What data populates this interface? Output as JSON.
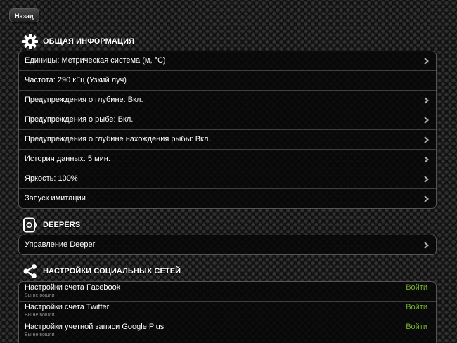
{
  "nav": {
    "back_label": "Назад"
  },
  "general": {
    "title": "ОБЩАЯ ИНФОРМАЦИЯ",
    "icon": "gear-icon",
    "items": [
      {
        "label": "Единицы: Метрическая система (м, °C)",
        "chevron": true
      },
      {
        "label": "Частота: 290 кГц (Узкий луч)",
        "chevron": false
      },
      {
        "label": "Предупреждения о глубине: Вкл.",
        "chevron": true
      },
      {
        "label": "Предупреждения о рыбе: Вкл.",
        "chevron": true
      },
      {
        "label": "Предупреждения о глубине нахождения рыбы: Вкл.",
        "chevron": true
      },
      {
        "label": "История данных: 5 мин.",
        "chevron": true
      },
      {
        "label": "Яркость: 100%",
        "chevron": true
      },
      {
        "label": "Запуск имитации",
        "chevron": true
      }
    ]
  },
  "deepers": {
    "title": "DEEPERS",
    "icon": "phone-device-icon",
    "items": [
      {
        "label": "Управление Deeper",
        "chevron": true
      }
    ]
  },
  "social": {
    "title": "НАСТРОЙКИ СОЦИАЛЬНЫХ СЕТЕЙ",
    "icon": "share-icon",
    "items": [
      {
        "label": "Настройки счета Facebook",
        "status": "Вы не вошли",
        "action": "Войти"
      },
      {
        "label": "Настройки счета Twitter",
        "status": "Вы не вошли",
        "action": "Войти"
      },
      {
        "label": "Настройки учетной записи Google Plus",
        "status": "Вы не вошли",
        "action": "Войти"
      }
    ]
  },
  "colors": {
    "accent_green": "#77b02a",
    "group_border": "#555555",
    "text": "#ffffff",
    "subtext": "#8c8c8c"
  }
}
